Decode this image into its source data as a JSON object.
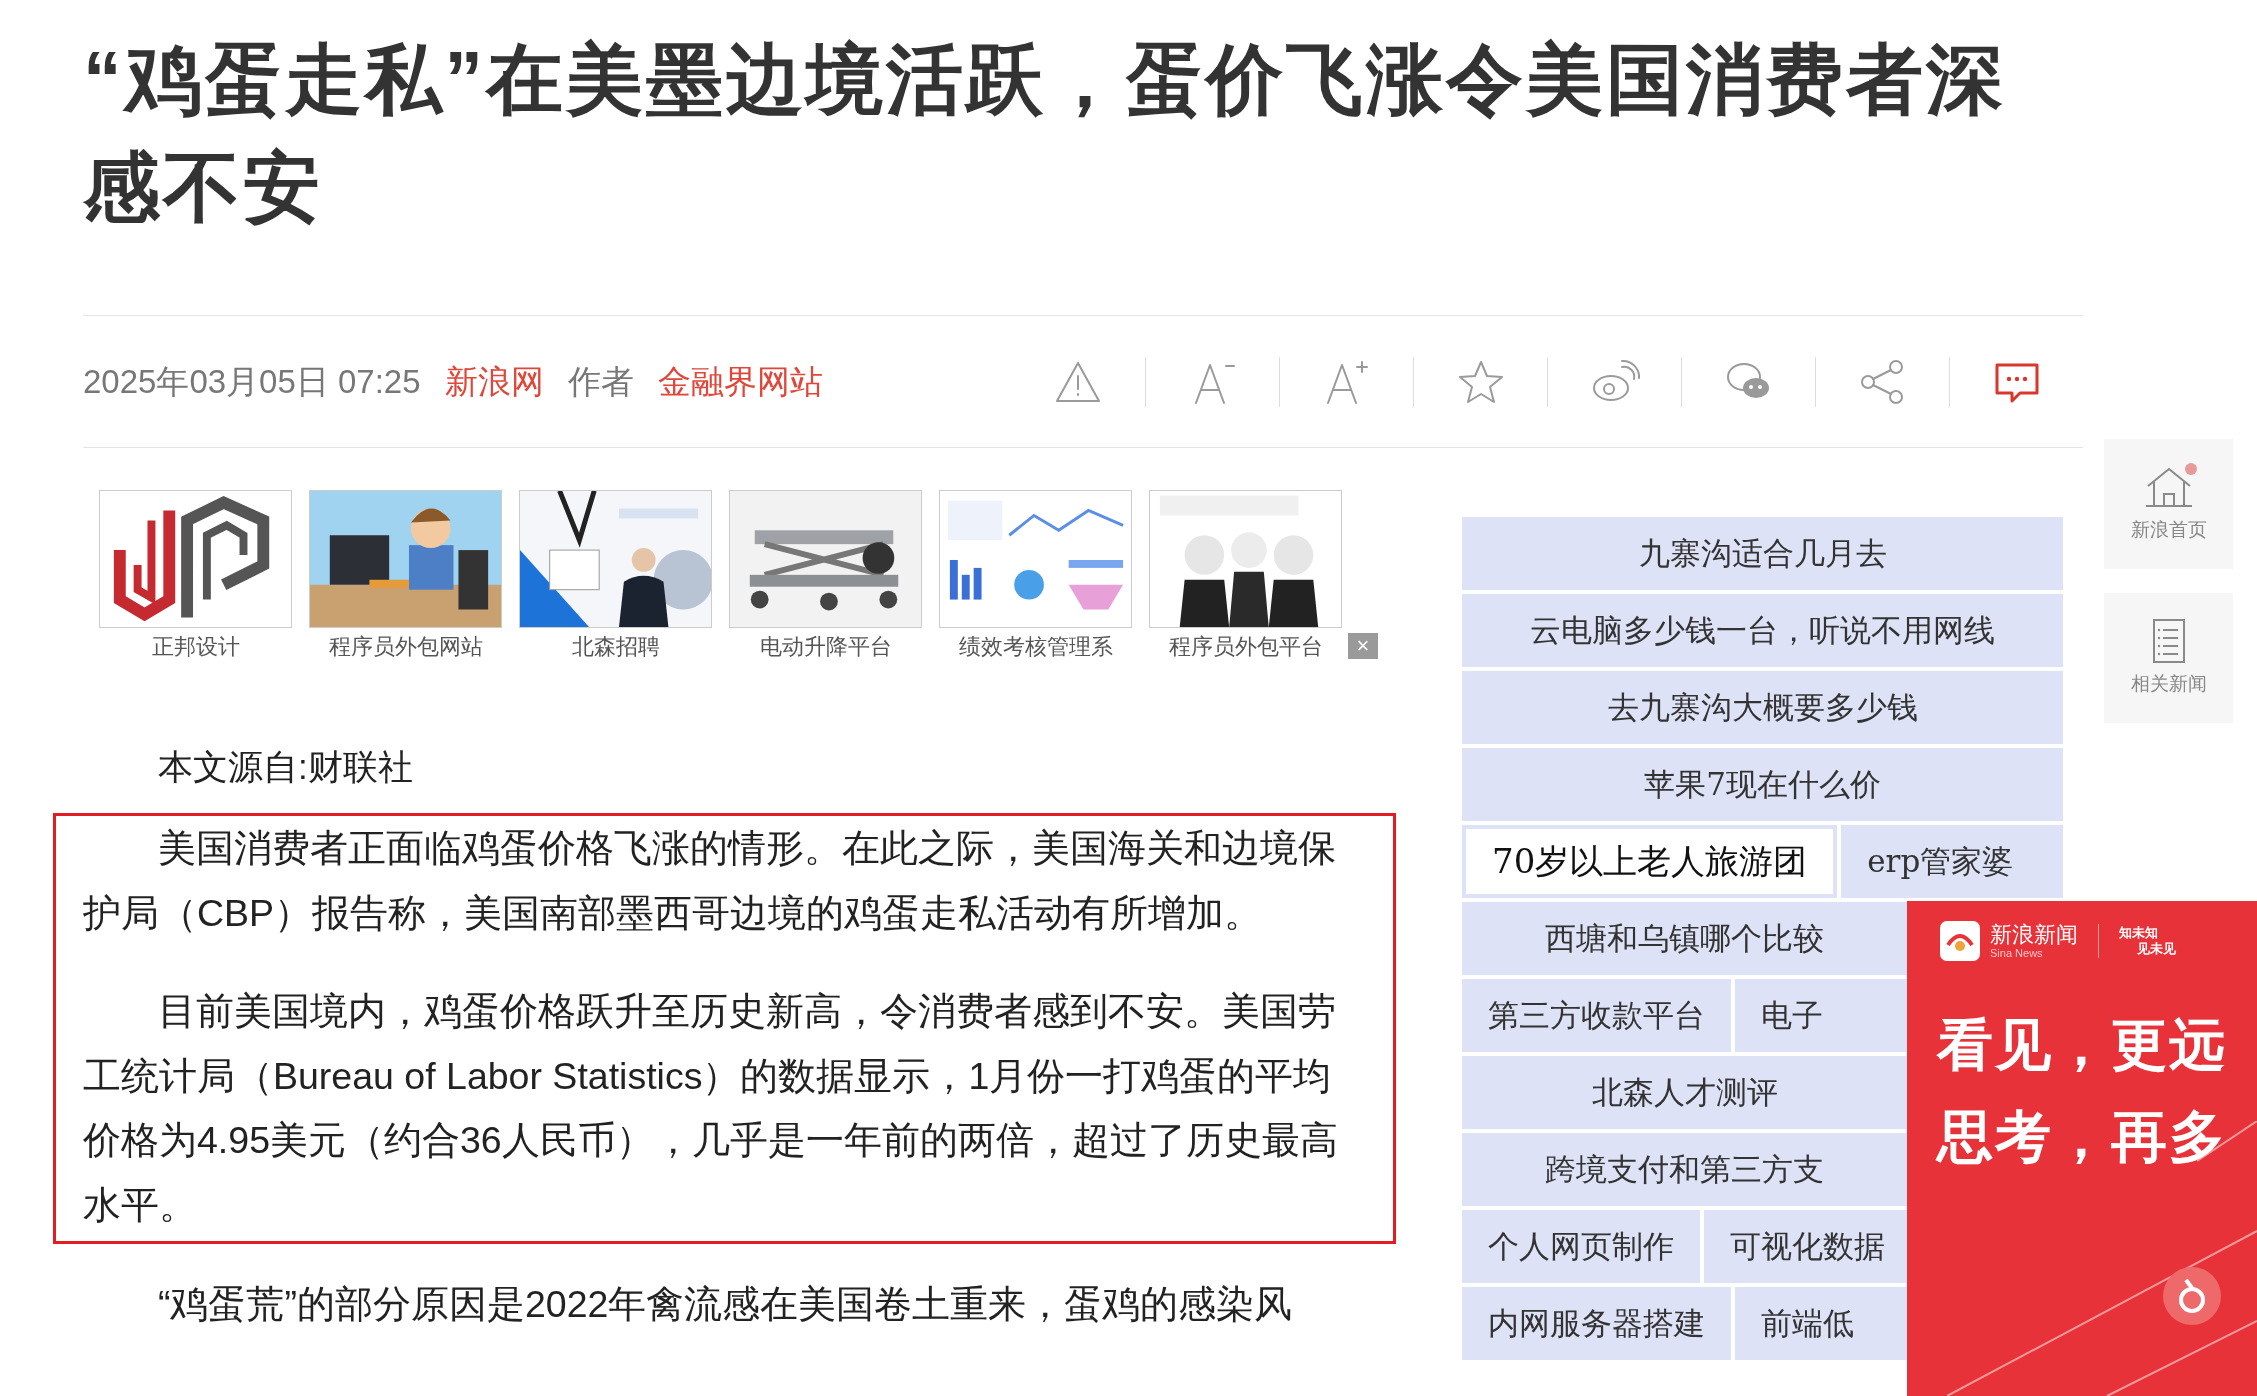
{
  "title": "“鸡蛋走私”在美墨边境活跃，蛋价飞涨令美国消费者深感不安",
  "meta": {
    "date": "2025年03月05日 07:25",
    "source": "新浪网",
    "author_label": "作者",
    "author": "金融界网站"
  },
  "toolbar": [
    {
      "kind": "report"
    },
    {
      "kind": "font-smaller"
    },
    {
      "kind": "font-larger"
    },
    {
      "kind": "favorite"
    },
    {
      "kind": "weibo"
    },
    {
      "kind": "wechat"
    },
    {
      "kind": "share"
    },
    {
      "kind": "comment"
    }
  ],
  "ads": {
    "items": [
      {
        "caption": "正邦设计",
        "kind": "picture"
      },
      {
        "caption": "程序员外包网站",
        "kind": "picture"
      },
      {
        "caption": "北森招聘",
        "kind": "picture"
      },
      {
        "caption": "电动升降平台",
        "kind": "picture"
      },
      {
        "caption": "绩效考核管理系",
        "kind": "picture"
      },
      {
        "caption": "程序员外包平台",
        "kind": "picture"
      }
    ],
    "close": "×"
  },
  "article": {
    "source_line": "本文源自:财联社",
    "paragraphs": [
      {
        "text": "美国消费者正面临鸡蛋价格飞涨的情形。在此之际，美国海关和边境保护局（CBP）报告称，美国南部墨西哥边境的鸡蛋走私活动有所增加。",
        "highlighted": true
      },
      {
        "text": "目前美国境内，鸡蛋价格跃升至历史新高，令消费者感到不安。美国劳工统计局（Bureau of Labor Statistics）的数据显示，1月份一打鸡蛋的平均价格为4.95美元（约合36人民币），几乎是一年前的两倍，超过了历史最高水平。",
        "highlighted": true
      },
      {
        "text": "“鸡蛋荒”的部分原因是2022年禽流感在美国卷土重来，蛋鸡的感染风",
        "highlighted": false
      }
    ]
  },
  "related_links": [
    {
      "cells": [
        {
          "text": "九寨沟适合几月去",
          "highlighted": false
        }
      ]
    },
    {
      "cells": [
        {
          "text": "云电脑多少钱一台，听说不用网线",
          "highlighted": false
        }
      ]
    },
    {
      "cells": [
        {
          "text": "去九寨沟大概要多少钱",
          "highlighted": false
        }
      ]
    },
    {
      "cells": [
        {
          "text": "苹果7现在什么价",
          "highlighted": false
        }
      ]
    },
    {
      "cells": [
        {
          "text": "70岁以上老人旅游团",
          "highlighted": true
        },
        {
          "text": "erp管家婆",
          "highlighted": false
        }
      ]
    },
    {
      "cells": [
        {
          "text": "西塘和乌镇哪个比较",
          "highlighted": false
        }
      ]
    },
    {
      "cells": [
        {
          "text": "第三方收款平台",
          "highlighted": false
        },
        {
          "text": "电子",
          "highlighted": false
        }
      ]
    },
    {
      "cells": [
        {
          "text": "北森人才测评",
          "highlighted": false
        }
      ]
    },
    {
      "cells": [
        {
          "text": "跨境支付和第三方支",
          "highlighted": false
        }
      ]
    },
    {
      "cells": [
        {
          "text": "个人网页制作",
          "highlighted": false
        },
        {
          "text": "可视化数据",
          "highlighted": false
        }
      ]
    },
    {
      "cells": [
        {
          "text": "内网服务器搭建",
          "highlighted": false
        },
        {
          "text": "前端低",
          "highlighted": false
        }
      ]
    }
  ],
  "side_tools": [
    {
      "kind": "home",
      "label": "新浪首页",
      "badge": true
    },
    {
      "kind": "list",
      "label": "相关新闻",
      "badge": false
    }
  ],
  "promo": {
    "brand": "新浪新闻",
    "brand_en": "Sina News",
    "slogan_lines": [
      "知未知",
      "见未见"
    ],
    "headline_lines": [
      "看见，更远",
      "思考，再多"
    ]
  }
}
